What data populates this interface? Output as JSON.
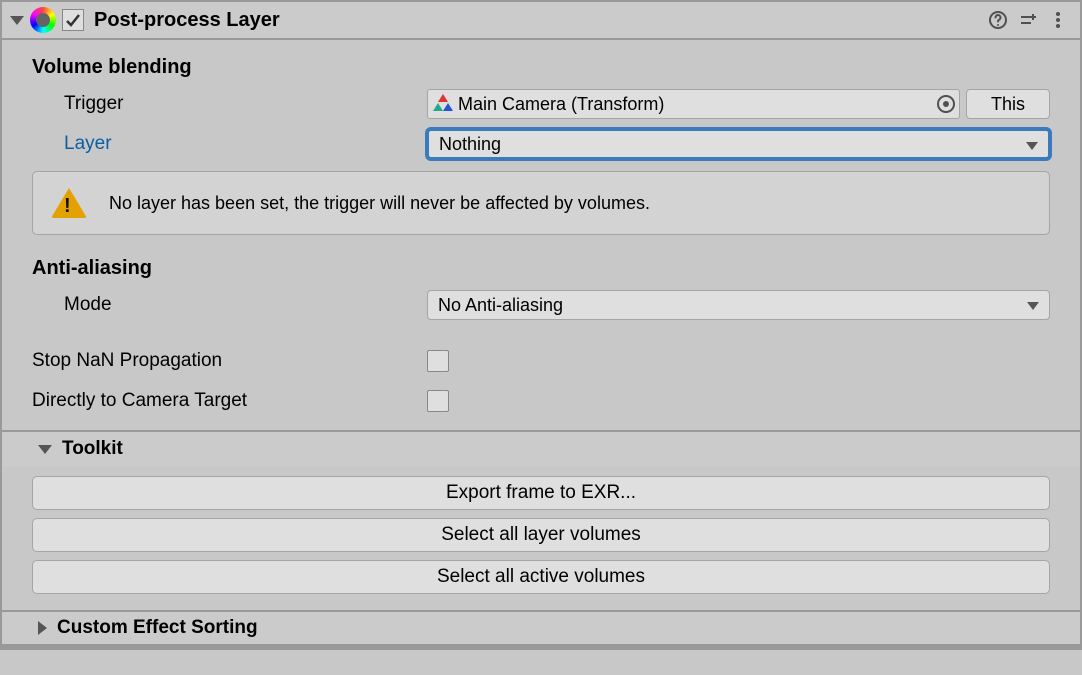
{
  "header": {
    "title": "Post-process Layer",
    "enabled": true
  },
  "volume_blending": {
    "title": "Volume blending",
    "trigger_label": "Trigger",
    "trigger_value": "Main Camera (Transform)",
    "this_button": "This",
    "layer_label": "Layer",
    "layer_value": "Nothing",
    "warning": "No layer has been set, the trigger will never be affected by volumes."
  },
  "anti_aliasing": {
    "title": "Anti-aliasing",
    "mode_label": "Mode",
    "mode_value": "No Anti-aliasing"
  },
  "stop_nan": {
    "label": "Stop NaN Propagation",
    "checked": false
  },
  "direct_camera": {
    "label": "Directly to Camera Target",
    "checked": false
  },
  "toolkit": {
    "title": "Toolkit",
    "export_btn": "Export frame to EXR...",
    "select_layer_btn": "Select all layer volumes",
    "select_active_btn": "Select all active volumes"
  },
  "custom_sort": {
    "title": "Custom Effect Sorting"
  }
}
